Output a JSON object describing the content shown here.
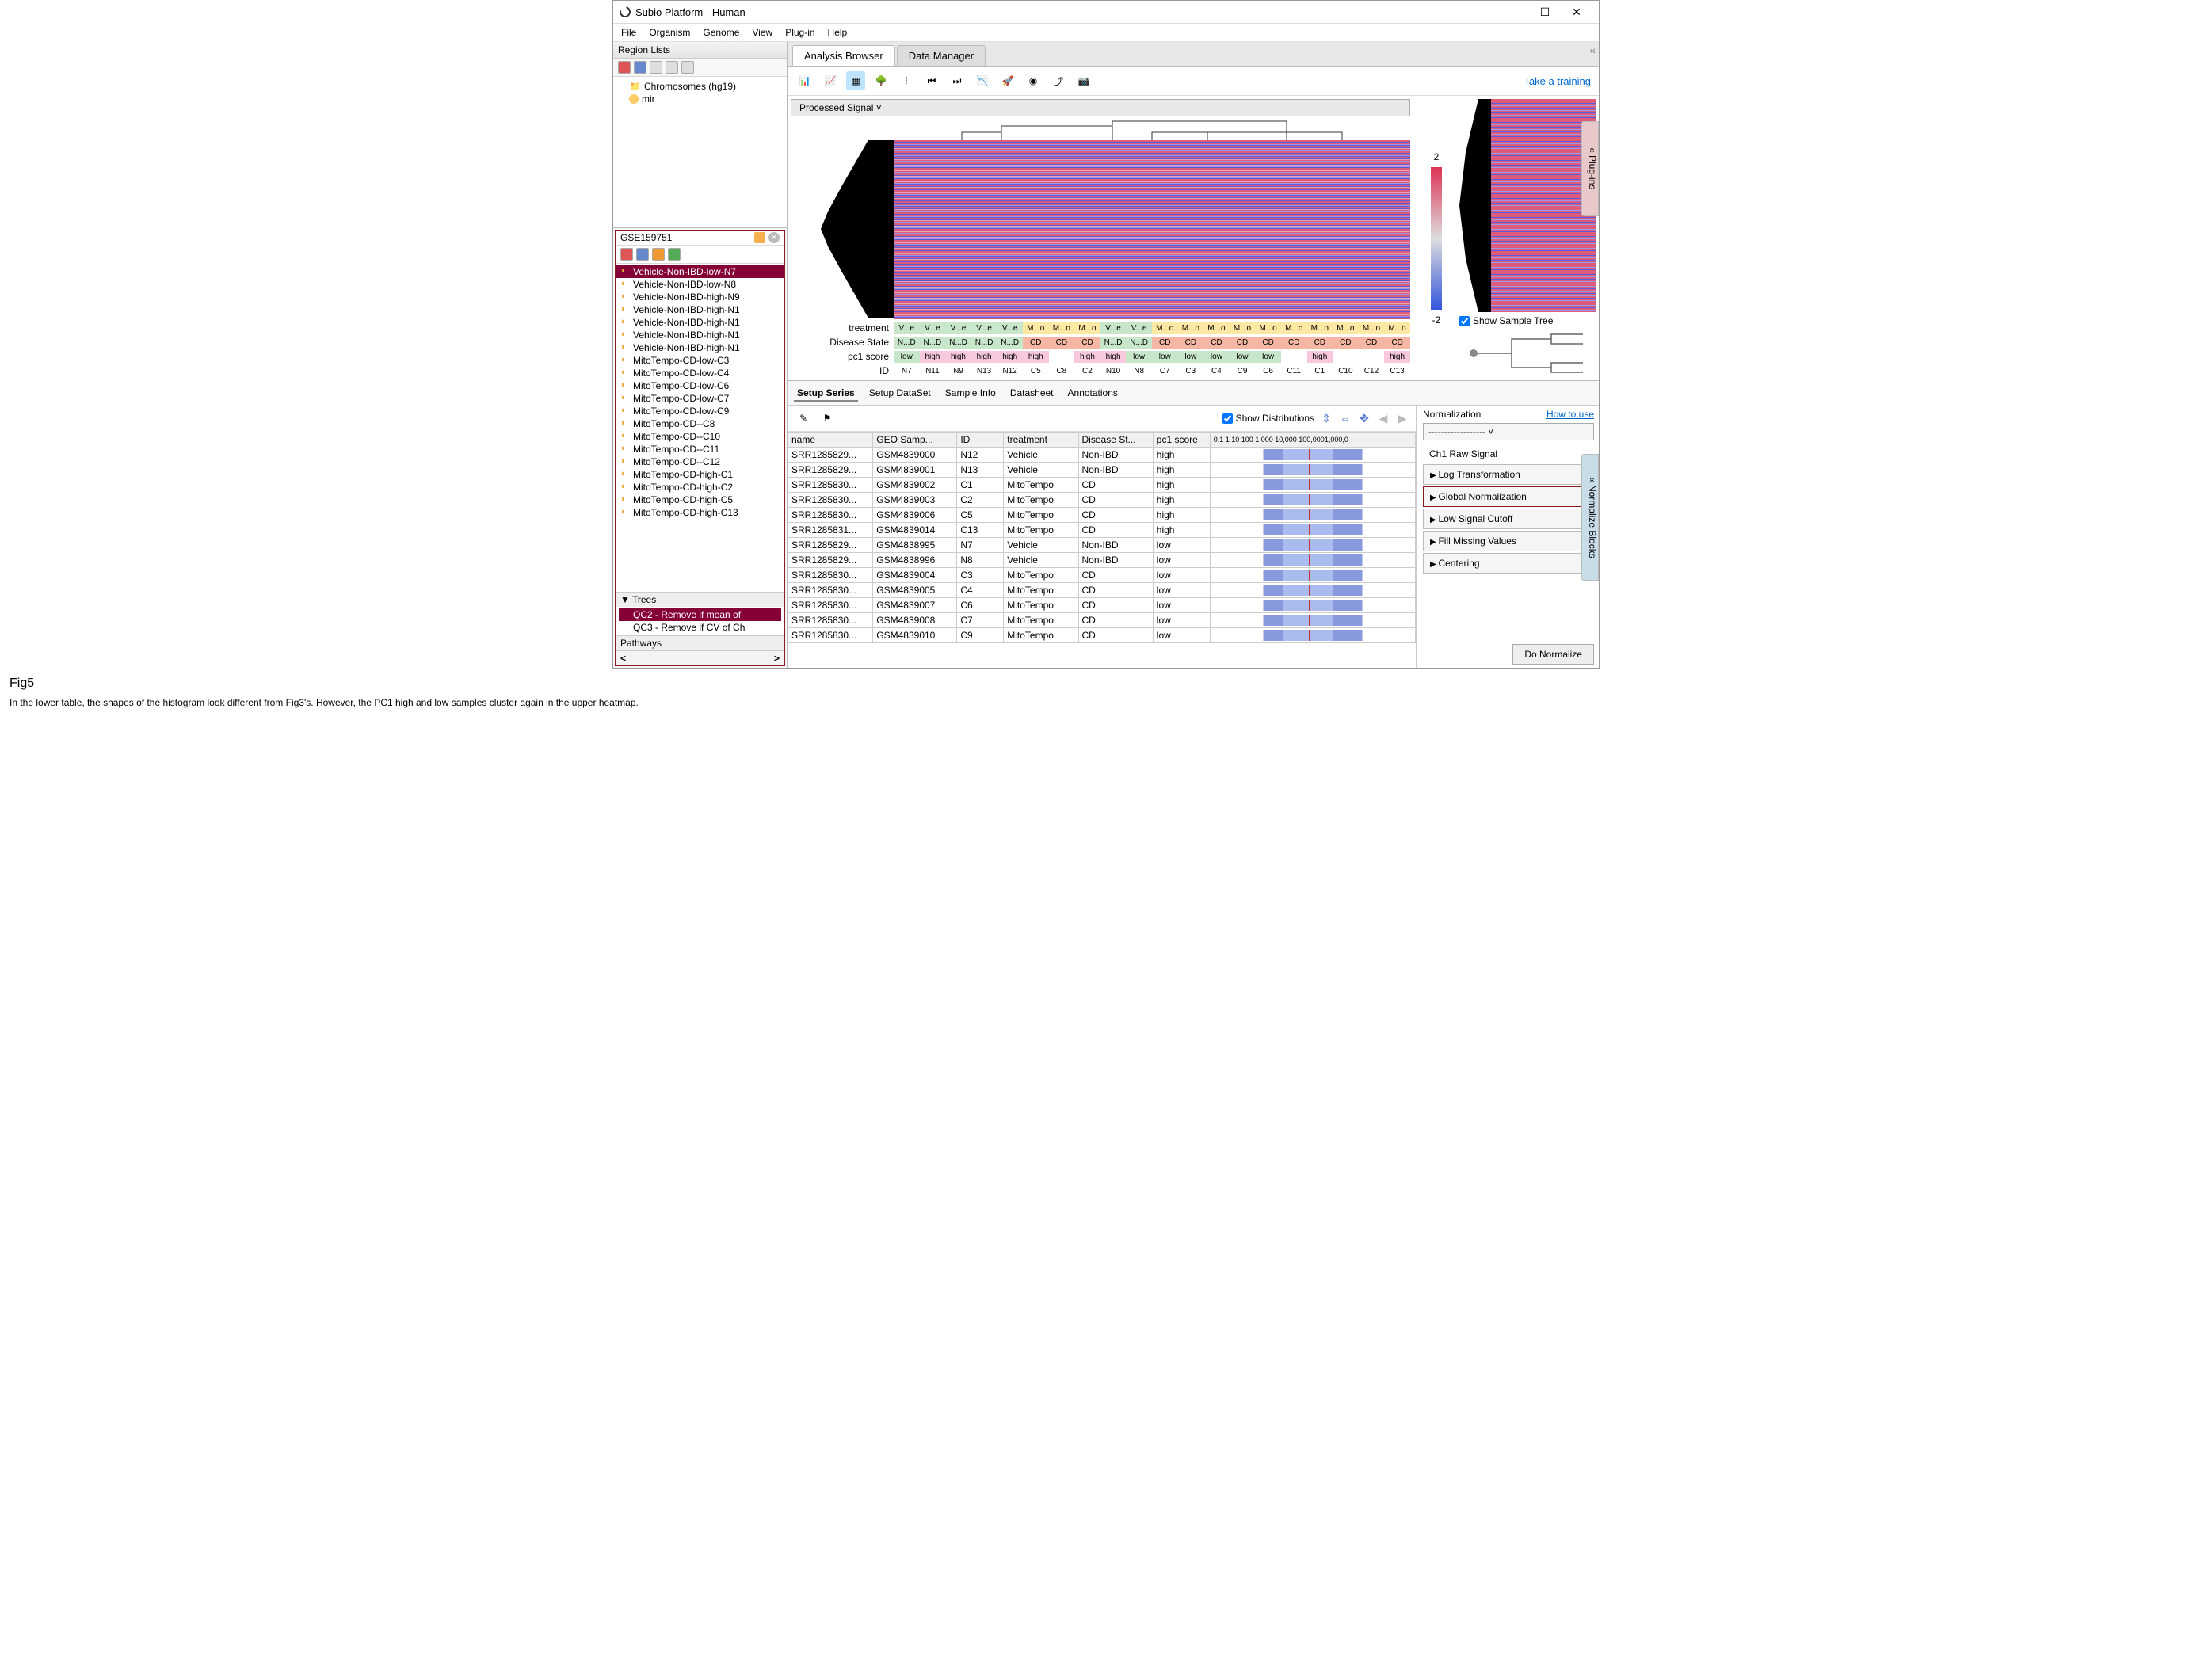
{
  "window": {
    "title": "Subio Platform - Human"
  },
  "menu": [
    "File",
    "Organism",
    "Genome",
    "View",
    "Plug-in",
    "Help"
  ],
  "region_lists": {
    "title": "Region Lists",
    "items": [
      "Chromosomes (hg19)",
      "mir"
    ]
  },
  "gse": {
    "id": "GSE159751",
    "samples": [
      {
        "label": "Vehicle-Non-IBD-low-N7",
        "sel": true
      },
      {
        "label": "Vehicle-Non-IBD-low-N8"
      },
      {
        "label": "Vehicle-Non-IBD-high-N9"
      },
      {
        "label": "Vehicle-Non-IBD-high-N1"
      },
      {
        "label": "Vehicle-Non-IBD-high-N1"
      },
      {
        "label": "Vehicle-Non-IBD-high-N1"
      },
      {
        "label": "Vehicle-Non-IBD-high-N1"
      },
      {
        "label": "MitoTempo-CD-low-C3"
      },
      {
        "label": "MitoTempo-CD-low-C4"
      },
      {
        "label": "MitoTempo-CD-low-C6"
      },
      {
        "label": "MitoTempo-CD-low-C7"
      },
      {
        "label": "MitoTempo-CD-low-C9"
      },
      {
        "label": "MitoTempo-CD--C8"
      },
      {
        "label": "MitoTempo-CD--C10"
      },
      {
        "label": "MitoTempo-CD--C11"
      },
      {
        "label": "MitoTempo-CD--C12"
      },
      {
        "label": "MitoTempo-CD-high-C1"
      },
      {
        "label": "MitoTempo-CD-high-C2"
      },
      {
        "label": "MitoTempo-CD-high-C5"
      },
      {
        "label": "MitoTempo-CD-high-C13"
      }
    ]
  },
  "trees_section": {
    "title": "Trees",
    "items": [
      {
        "label": "QC2 - Remove if mean of",
        "sel": true
      },
      {
        "label": "QC3 - Remove if CV of Ch"
      }
    ]
  },
  "pathways_title": "Pathways",
  "main_tabs": [
    "Analysis Browser",
    "Data Manager"
  ],
  "toolbar_link": "Take a training",
  "signal_dropdown": "Processed Signal",
  "annot_labels": {
    "treatment": "treatment",
    "disease": "Disease State",
    "pc1": "pc1 score",
    "id": "ID"
  },
  "annot_cols": [
    {
      "id": "N7",
      "trt": "V...e",
      "trt_c": "#c8e6c9",
      "ds": "N...D",
      "ds_c": "#c8e6c9",
      "pc1": "low",
      "pc1_c": "#c8e6c9"
    },
    {
      "id": "N11",
      "trt": "V...e",
      "trt_c": "#c8e6c9",
      "ds": "N...D",
      "ds_c": "#c8e6c9",
      "pc1": "high",
      "pc1_c": "#f8c8dc"
    },
    {
      "id": "N9",
      "trt": "V...e",
      "trt_c": "#c8e6c9",
      "ds": "N...D",
      "ds_c": "#c8e6c9",
      "pc1": "high",
      "pc1_c": "#f8c8dc"
    },
    {
      "id": "N13",
      "trt": "V...e",
      "trt_c": "#c8e6c9",
      "ds": "N...D",
      "ds_c": "#c8e6c9",
      "pc1": "high",
      "pc1_c": "#f8c8dc"
    },
    {
      "id": "N12",
      "trt": "V...e",
      "trt_c": "#c8e6c9",
      "ds": "N...D",
      "ds_c": "#c8e6c9",
      "pc1": "high",
      "pc1_c": "#f8c8dc"
    },
    {
      "id": "C5",
      "trt": "M...o",
      "trt_c": "#ffe8a3",
      "ds": "CD",
      "ds_c": "#f5b7a3",
      "pc1": "high",
      "pc1_c": "#f8c8dc"
    },
    {
      "id": "C8",
      "trt": "M...o",
      "trt_c": "#ffe8a3",
      "ds": "CD",
      "ds_c": "#f5b7a3",
      "pc1": "",
      "pc1_c": "#ffffff"
    },
    {
      "id": "C2",
      "trt": "M...o",
      "trt_c": "#ffe8a3",
      "ds": "CD",
      "ds_c": "#f5b7a3",
      "pc1": "high",
      "pc1_c": "#f8c8dc"
    },
    {
      "id": "N10",
      "trt": "V...e",
      "trt_c": "#c8e6c9",
      "ds": "N...D",
      "ds_c": "#c8e6c9",
      "pc1": "high",
      "pc1_c": "#f8c8dc"
    },
    {
      "id": "N8",
      "trt": "V...e",
      "trt_c": "#c8e6c9",
      "ds": "N...D",
      "ds_c": "#c8e6c9",
      "pc1": "low",
      "pc1_c": "#c8e6c9"
    },
    {
      "id": "C7",
      "trt": "M...o",
      "trt_c": "#ffe8a3",
      "ds": "CD",
      "ds_c": "#f5b7a3",
      "pc1": "low",
      "pc1_c": "#c8e6c9"
    },
    {
      "id": "C3",
      "trt": "M...o",
      "trt_c": "#ffe8a3",
      "ds": "CD",
      "ds_c": "#f5b7a3",
      "pc1": "low",
      "pc1_c": "#c8e6c9"
    },
    {
      "id": "C4",
      "trt": "M...o",
      "trt_c": "#ffe8a3",
      "ds": "CD",
      "ds_c": "#f5b7a3",
      "pc1": "low",
      "pc1_c": "#c8e6c9"
    },
    {
      "id": "C9",
      "trt": "M...o",
      "trt_c": "#ffe8a3",
      "ds": "CD",
      "ds_c": "#f5b7a3",
      "pc1": "low",
      "pc1_c": "#c8e6c9"
    },
    {
      "id": "C6",
      "trt": "M...o",
      "trt_c": "#ffe8a3",
      "ds": "CD",
      "ds_c": "#f5b7a3",
      "pc1": "low",
      "pc1_c": "#c8e6c9"
    },
    {
      "id": "C11",
      "trt": "M...o",
      "trt_c": "#ffe8a3",
      "ds": "CD",
      "ds_c": "#f5b7a3",
      "pc1": "",
      "pc1_c": "#ffffff"
    },
    {
      "id": "C1",
      "trt": "M...o",
      "trt_c": "#ffe8a3",
      "ds": "CD",
      "ds_c": "#f5b7a3",
      "pc1": "high",
      "pc1_c": "#f8c8dc"
    },
    {
      "id": "C10",
      "trt": "M...o",
      "trt_c": "#ffe8a3",
      "ds": "CD",
      "ds_c": "#f5b7a3",
      "pc1": "",
      "pc1_c": "#ffffff"
    },
    {
      "id": "C12",
      "trt": "M...o",
      "trt_c": "#ffe8a3",
      "ds": "CD",
      "ds_c": "#f5b7a3",
      "pc1": "",
      "pc1_c": "#ffffff"
    },
    {
      "id": "C13",
      "trt": "M...o",
      "trt_c": "#ffe8a3",
      "ds": "CD",
      "ds_c": "#f5b7a3",
      "pc1": "high",
      "pc1_c": "#f8c8dc"
    }
  ],
  "legend": {
    "top": "2",
    "mid": "0",
    "bot": "-2"
  },
  "show_sample_tree": "Show Sample Tree",
  "side_tab1": "Plug-ins",
  "side_tab2": "Normalize Blocks",
  "lower_tabs": [
    "Setup Series",
    "Setup DataSet",
    "Sample Info",
    "Datasheet",
    "Annotations"
  ],
  "show_dist": "Show Distributions",
  "table": {
    "headers": [
      "name",
      "GEO Samp...",
      "ID",
      "treatment",
      "Disease St...",
      "pc1 score"
    ],
    "axis_ticks": "0.1        1        10       100     1,000   10,000 100,0001,000,0",
    "rows": [
      {
        "name": "SRR1285829...",
        "geo": "GSM4839000",
        "id": "N12",
        "trt": "Vehicle",
        "ds": "Non-IBD",
        "pc1": "high"
      },
      {
        "name": "SRR1285829...",
        "geo": "GSM4839001",
        "id": "N13",
        "trt": "Vehicle",
        "ds": "Non-IBD",
        "pc1": "high"
      },
      {
        "name": "SRR1285830...",
        "geo": "GSM4839002",
        "id": "C1",
        "trt": "MitoTempo",
        "ds": "CD",
        "pc1": "high"
      },
      {
        "name": "SRR1285830...",
        "geo": "GSM4839003",
        "id": "C2",
        "trt": "MitoTempo",
        "ds": "CD",
        "pc1": "high"
      },
      {
        "name": "SRR1285830...",
        "geo": "GSM4839006",
        "id": "C5",
        "trt": "MitoTempo",
        "ds": "CD",
        "pc1": "high"
      },
      {
        "name": "SRR1285831...",
        "geo": "GSM4839014",
        "id": "C13",
        "trt": "MitoTempo",
        "ds": "CD",
        "pc1": "high"
      },
      {
        "name": "SRR1285829...",
        "geo": "GSM4838995",
        "id": "N7",
        "trt": "Vehicle",
        "ds": "Non-IBD",
        "pc1": "low"
      },
      {
        "name": "SRR1285829...",
        "geo": "GSM4838996",
        "id": "N8",
        "trt": "Vehicle",
        "ds": "Non-IBD",
        "pc1": "low"
      },
      {
        "name": "SRR1285830...",
        "geo": "GSM4839004",
        "id": "C3",
        "trt": "MitoTempo",
        "ds": "CD",
        "pc1": "low"
      },
      {
        "name": "SRR1285830...",
        "geo": "GSM4839005",
        "id": "C4",
        "trt": "MitoTempo",
        "ds": "CD",
        "pc1": "low"
      },
      {
        "name": "SRR1285830...",
        "geo": "GSM4839007",
        "id": "C6",
        "trt": "MitoTempo",
        "ds": "CD",
        "pc1": "low"
      },
      {
        "name": "SRR1285830...",
        "geo": "GSM4839008",
        "id": "C7",
        "trt": "MitoTempo",
        "ds": "CD",
        "pc1": "low"
      },
      {
        "name": "SRR1285830...",
        "geo": "GSM4839010",
        "id": "C9",
        "trt": "MitoTempo",
        "ds": "CD",
        "pc1": "low"
      }
    ]
  },
  "norm": {
    "title": "Normalization",
    "how": "How to use",
    "dd": "------------------",
    "raw": "Ch1 Raw Signal",
    "steps": [
      "Log Transformation",
      "Global Normalization",
      "Low Signal Cutoff",
      "Fill Missing Values",
      "Centering"
    ],
    "highlight_idx": 1,
    "do": "Do Normalize"
  },
  "caption_fig": "Fig5",
  "caption_text": "In the lower table, the shapes of the histogram look different from Fig3's. However, the PC1 high and low samples cluster again in the upper heatmap.",
  "chart_data": {
    "type": "heatmap",
    "title": "Processed Signal clustered heatmap",
    "color_scale": {
      "min": -2,
      "mid": 0,
      "max": 2,
      "min_color": "#3355dd",
      "mid_color": "#dddddd",
      "max_color": "#dd3355"
    },
    "column_ids": [
      "N7",
      "N11",
      "N9",
      "N13",
      "N12",
      "C5",
      "C8",
      "C2",
      "N10",
      "N8",
      "C7",
      "C3",
      "C4",
      "C9",
      "C6",
      "C11",
      "C1",
      "C10",
      "C12",
      "C13"
    ],
    "column_annotations": {
      "treatment": [
        "Vehicle",
        "Vehicle",
        "Vehicle",
        "Vehicle",
        "Vehicle",
        "MitoTempo",
        "MitoTempo",
        "MitoTempo",
        "Vehicle",
        "Vehicle",
        "MitoTempo",
        "MitoTempo",
        "MitoTempo",
        "MitoTempo",
        "MitoTempo",
        "MitoTempo",
        "MitoTempo",
        "MitoTempo",
        "MitoTempo",
        "MitoTempo"
      ],
      "disease_state": [
        "Non-IBD",
        "Non-IBD",
        "Non-IBD",
        "Non-IBD",
        "Non-IBD",
        "CD",
        "CD",
        "CD",
        "Non-IBD",
        "Non-IBD",
        "CD",
        "CD",
        "CD",
        "CD",
        "CD",
        "CD",
        "CD",
        "CD",
        "CD",
        "CD"
      ],
      "pc1_score": [
        "low",
        "high",
        "high",
        "high",
        "high",
        "high",
        "",
        "high",
        "high",
        "low",
        "low",
        "low",
        "low",
        "low",
        "low",
        "",
        "high",
        "",
        "",
        "high"
      ]
    },
    "note": "Per-cell intensity values are not individually readable from the screenshot (thousands of rows); only column metadata and color-scale are captured."
  }
}
